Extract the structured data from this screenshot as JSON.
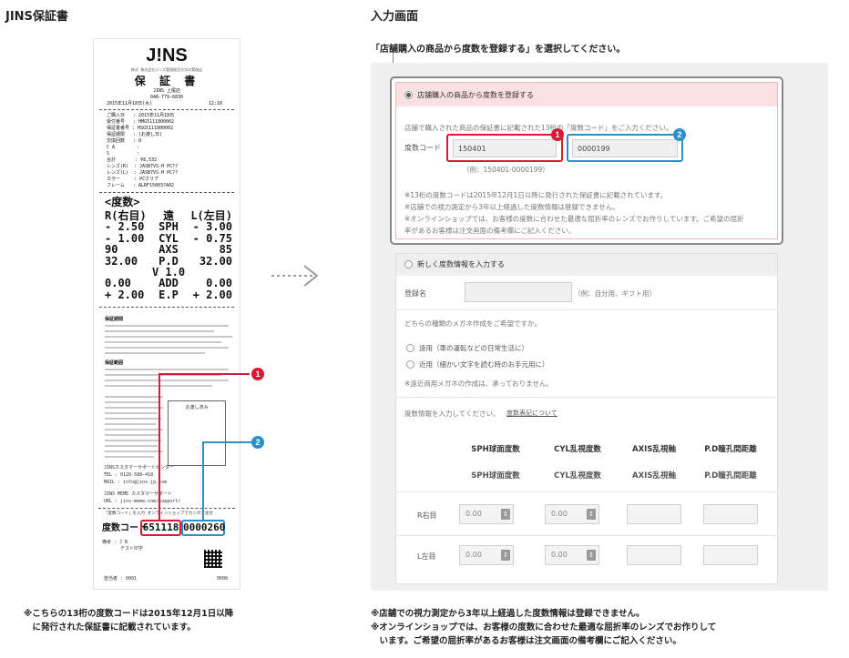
{
  "left_section": {
    "title": "JINS保証書"
  },
  "right_section": {
    "title": "入力画面",
    "instruction": "「店舗購入の商品から度数を登録する」を選択してください。"
  },
  "receipt": {
    "logo": "J!NS",
    "company": "株式 株式会社ジンズ管理販売方式の実施店",
    "title": "保 証 書",
    "store": "JINS 上尾店",
    "phone": "048-779-6830",
    "date_line": "2015年11月18日(水)",
    "time": "12:18",
    "lines": [
      "ご購入日   : 2015年11月18日",
      "受付番号   : HMG5111800002",
      "保証書番号 : HSG5111800002",
      "保証期限   : (お渡し日)",
      "交換回数   : 0",
      "C A        :",
      "S          :",
      "合計       : ¥8,532",
      "レンズ(R)  : JASB7VS-H PC??",
      "レンズ(L)  : JASB7VS-H PC??",
      "カラー     : PCクリア",
      "フレーム   : ALRF15003?A02"
    ],
    "rx_header": "<度数>",
    "rx_rows": [
      [
        "R(右目)",
        "遠",
        "L(左目)"
      ],
      [
        "- 2.50",
        "SPH",
        "- 3.00"
      ],
      [
        "- 1.00",
        "CYL",
        "- 0.75"
      ],
      [
        "90",
        "AXS",
        "85"
      ],
      [
        "32.00",
        "P.D",
        "32.00"
      ],
      [
        "",
        "V 1.0",
        ""
      ],
      [
        "0.00",
        "ADD",
        "0.00"
      ],
      [
        "+ 2.00",
        "E.P",
        "+ 2.00"
      ]
    ],
    "guarantee_title": "保証期間",
    "guarantee_scope": "保証範囲",
    "stamp_label": "お渡し済み",
    "support_center": "JINSカスタマーサポートセンター",
    "support_tel": "TEL : 0120-588-418",
    "support_mail": "MAIL : info@jins-jp.com",
    "meme_center": "JINS MEME カスタマーサポート",
    "meme_url": "URL : jins-meme.com/support/",
    "online_line": "「度数コード」を入力 オンラインショップでカンタン注文",
    "code_label": "度数コード",
    "code_part1": "651118",
    "code_part2": "0000260",
    "remark": "備考 : J B",
    "remark2": "テスト印字",
    "footer_no": "担当者 : 0001",
    "footer_num": "0008"
  },
  "badges": {
    "one": "1",
    "two": "2"
  },
  "option1": {
    "label": "店舗購入の商品から度数を登録する",
    "hint": "店舗で購入された商品の保証書に記載された13桁の「度数コード」をご入力ください。",
    "field_label": "度数コード",
    "code1": "150401",
    "code2": "0000199",
    "example": "（例：150401-0000199）",
    "notes": [
      "※13桁の度数コードは2015年12月1日以降に発行された保証書に記載されています。",
      "※店舗での視力測定から3年以上経過した度数情報は登録できません。",
      "※オンラインショップでは、お客様の度数に合わせた最適な屈折率のレンズでお作りしています。ご希望の屈折",
      "率があるお客様は注文画面の備考欄にご記入ください。"
    ]
  },
  "option2": {
    "label": "新しく度数情報を入力する",
    "name_label": "登録名",
    "name_hint": "（例：自分用、ギフト用）",
    "question": "どちらの種類のメガネ作成をご希望ですか。",
    "choice_far": "遠用（車の運転などの日常生活に）",
    "choice_near": "近用（細かい文字を読む時のお手元用に）",
    "note": "※遠近両用メガネの作成は、承っておりません。",
    "prompt": "度数情報を入力してください。",
    "link": "度数表記について",
    "columns": [
      "SPH球面度数",
      "CYL乱視度数",
      "AXIS乱視軸",
      "P.D瞳孔間距離"
    ],
    "row_right": "R右目",
    "row_left": "L左目",
    "default_value": "0.00",
    "stepper": "↕"
  },
  "footnotes": {
    "left": [
      "※こちらの13桁の度数コードは2015年12月1日以降",
      "　に発行された保証書に記載されています。"
    ],
    "right": [
      "※店舗での視力測定から3年以上経過した度数情報は登録できません。",
      "※オンラインショップでは、お客様の度数に合わせた最適な屈折率のレンズでお作りして",
      "　います。ご希望の屈折率があるお客様は注文画面の備考欄にご記入ください。"
    ]
  },
  "colors": {
    "red": "#d81b34",
    "blue": "#2a90c9",
    "pink": "#fae0e2",
    "arrow": "#9a9a9a"
  },
  "icons": {
    "arrow": "dotted-arrow-right-icon"
  }
}
